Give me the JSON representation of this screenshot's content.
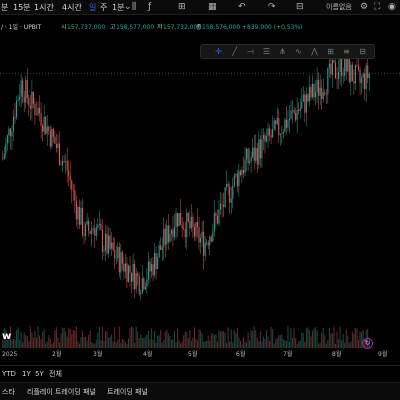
{
  "topbar": {
    "intervals": [
      "분",
      "15분",
      "1시간",
      "4시간",
      "일",
      "주",
      "1분"
    ],
    "selected_interval": "일",
    "chart_name_button": "이름없음",
    "icons": [
      "chevron-down-icon",
      "candles-icon",
      "indicators-icon",
      "compare-icon",
      "layout-icon",
      "undo-icon",
      "redo-icon",
      "grid-icon",
      "settings-icon",
      "fullscreen-icon",
      "camera-icon"
    ]
  },
  "legend": {
    "symbol": "/ · 1일 · UPBIT",
    "open_label": "시",
    "open_value": "157,737,000",
    "high_label": "고",
    "high_value": "158,577,000",
    "low_label": "저",
    "low_value": "157,732,000",
    "close_label": "종",
    "close_value": "158,576,000",
    "change": "+839,000 (+0.53%)"
  },
  "drawing_toolbar": {
    "tools": [
      "crosshair-icon",
      "trendline-icon",
      "horizontal-ray-icon",
      "fib-icon",
      "pitchfork-icon",
      "brush-icon",
      "pattern-icon",
      "long-position-icon",
      "text-icon",
      "measure-icon"
    ]
  },
  "watermark": "w",
  "x_axis_labels": [
    "2025",
    "2월",
    "3월",
    "4월",
    "5월",
    "6월",
    "7월",
    "8월",
    "9월"
  ],
  "range_bar": {
    "items": [
      "YTD",
      "1Y",
      "5Y",
      "전체"
    ]
  },
  "bottom_bar": {
    "tabs": [
      "스타",
      "리플레이 트레이딩 패널",
      "트레이딩 패널"
    ]
  },
  "colors": {
    "up": "#26a69a",
    "down": "#ef5350",
    "background": "#000000",
    "accent": "#2962ff"
  },
  "chart_data": {
    "type": "candlestick",
    "period": "1일",
    "x_labels": [
      "2025",
      "2월",
      "3월",
      "4월",
      "5월",
      "6월",
      "7월",
      "8월",
      "9월"
    ],
    "last_candle": {
      "open": 157737000,
      "high": 158577000,
      "low": 157732000,
      "close": 158576000,
      "change": 839000,
      "change_pct": 0.53
    },
    "approx_close_path": [
      140,
      148,
      156,
      152,
      150,
      146,
      142,
      138,
      130,
      124,
      126,
      122,
      120,
      118,
      116,
      114,
      116,
      120,
      124,
      128,
      126,
      124,
      122,
      126,
      130,
      134,
      138,
      140,
      142,
      144,
      146,
      148,
      150,
      152,
      154,
      156,
      158,
      160,
      158,
      156,
      158
    ]
  }
}
